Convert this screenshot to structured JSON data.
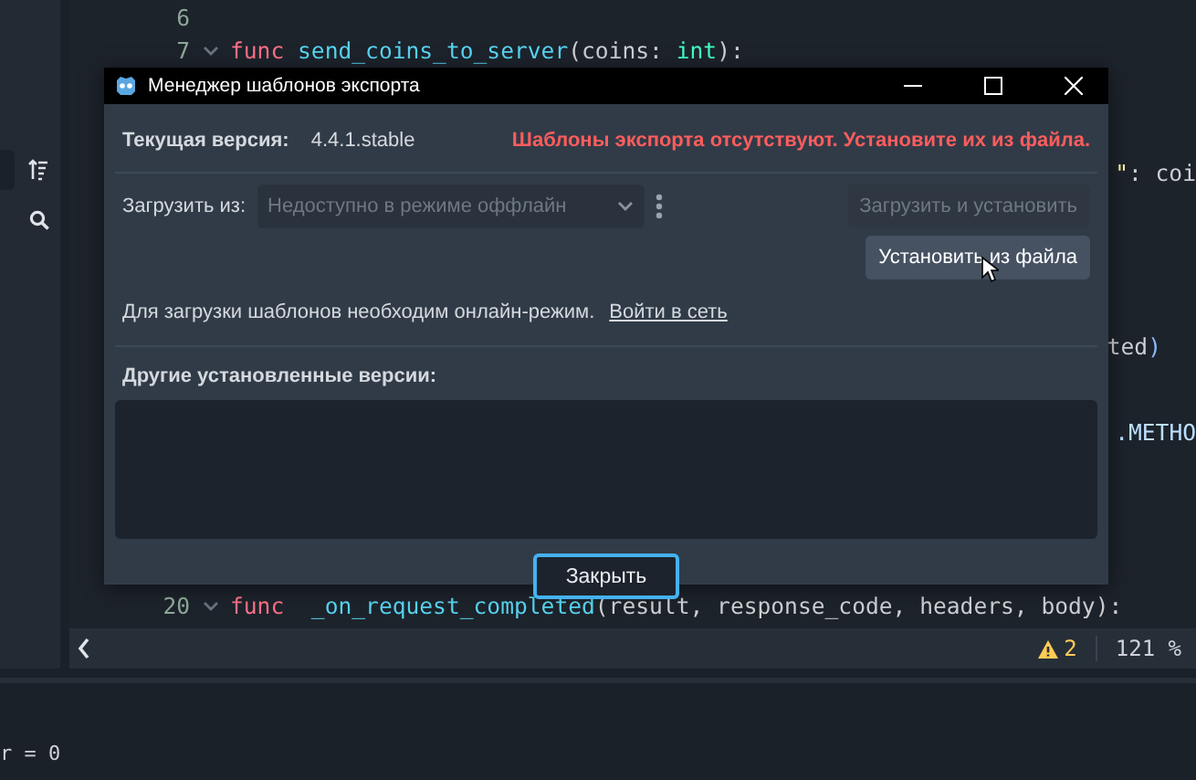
{
  "editor": {
    "lines": [
      {
        "number": "6",
        "foldable": false
      },
      {
        "number": "7",
        "foldable": true,
        "tokens": [
          {
            "kind": "keyword",
            "text": "func"
          },
          {
            "kind": "function",
            "text": " send_coins_to_server"
          },
          {
            "kind": "plain",
            "text": "(coins: "
          },
          {
            "kind": "type",
            "text": "int"
          },
          {
            "kind": "plain",
            "text": "):"
          }
        ]
      },
      {
        "tokens": [
          {
            "kind": "string",
            "text": "\""
          },
          {
            "kind": "plain",
            "text": ": coi"
          }
        ]
      },
      {
        "tokens": [
          {
            "kind": "plain",
            "text": "ted"
          },
          {
            "kind": "bracket",
            "text": ")"
          }
        ]
      },
      {
        "tokens": [
          {
            "kind": "constant",
            "text": ".METHO"
          }
        ]
      },
      {
        "number": "20",
        "foldable": true,
        "tokens": [
          {
            "kind": "keyword",
            "text": "func"
          },
          {
            "kind": "function",
            "text": "  _on_request_completed"
          },
          {
            "kind": "plain",
            "text": "(result, response_code, headers, body):"
          }
        ]
      }
    ]
  },
  "status_bar": {
    "warnings": "2",
    "zoom": "121 %"
  },
  "output": {
    "lines": [
      "r = 0"
    ]
  },
  "dialog": {
    "title": "Менеджер шаблонов экспорта",
    "current_version_label": "Текущая версия:",
    "current_version": "4.4.1.stable",
    "error": "Шаблоны экспорта отсутствуют. Установите их из файла.",
    "download_label": "Загрузить из:",
    "mirror_select": {
      "value": "Недоступно в режиме оффлайн",
      "disabled": true
    },
    "download_button": {
      "label": "Загрузить и установить",
      "disabled": true
    },
    "install_button": {
      "label": "Установить из файла",
      "hovered": true
    },
    "offline_notice": "Для загрузки шаблонов необходим онлайн-режим.",
    "go_online_link": "Войти в сеть",
    "installed_label": "Другие установленные версии:",
    "close_button": {
      "label": "Закрыть",
      "focused": true
    }
  }
}
